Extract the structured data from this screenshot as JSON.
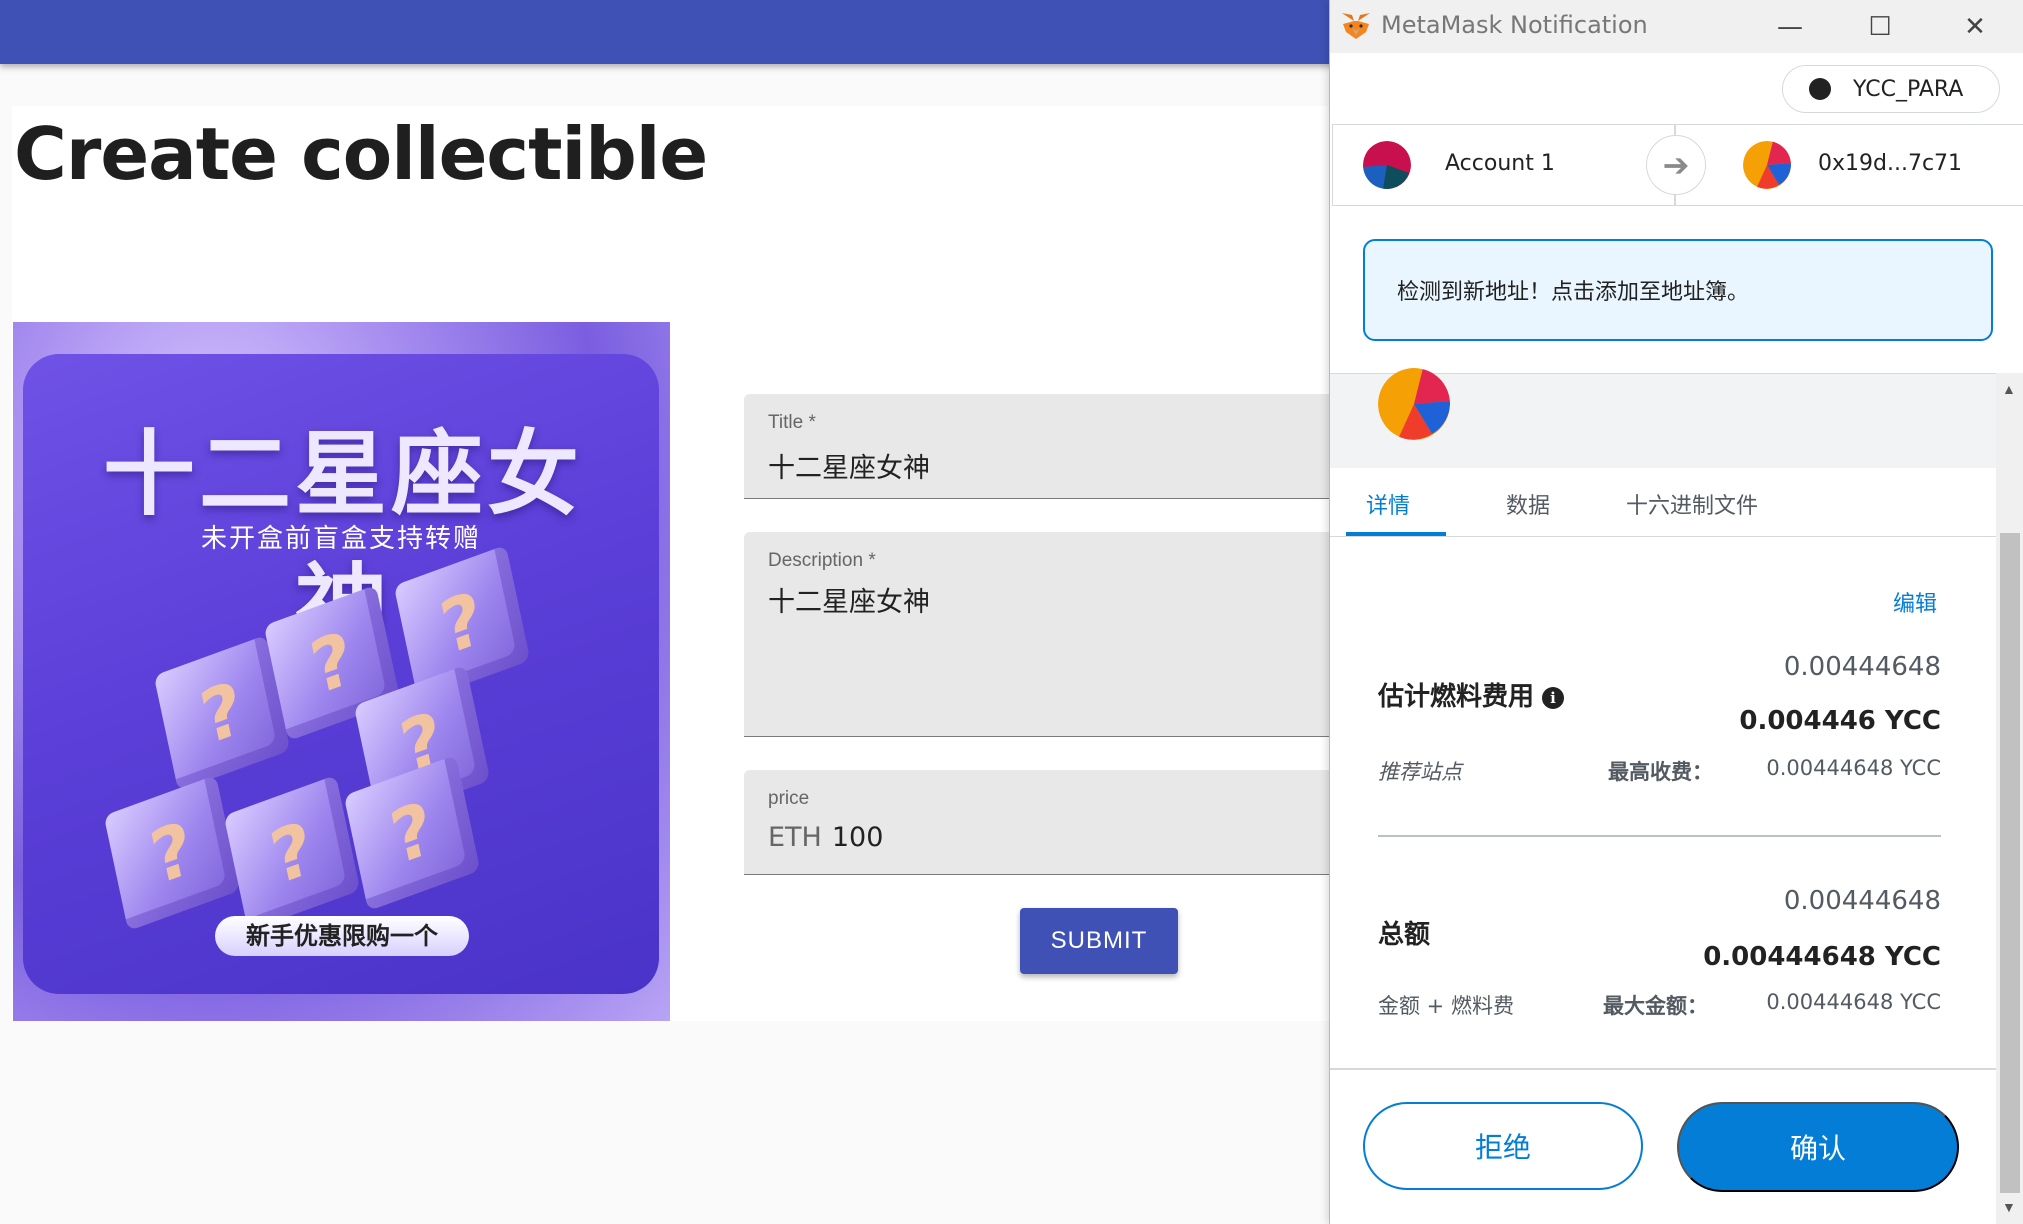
{
  "app": {
    "page_title": "Create collectible",
    "artwork": {
      "title": "十二星座女神",
      "subtitle": "未开盒前盲盒支持转赠",
      "badge": "新手优惠限购一个",
      "cube_glyph": "?"
    },
    "form": {
      "title_label": "Title *",
      "title_value": "十二星座女神",
      "description_label": "Description *",
      "description_value": "十二星座女神",
      "price_label": "price",
      "price_prefix": "ETH",
      "price_value": "100",
      "submit_label": "SUBMIT"
    },
    "colors": {
      "primary": "#3f51b5"
    }
  },
  "metamask": {
    "window_title": "MetaMask Notification",
    "window_buttons": {
      "minimize": "—",
      "maximize": "☐",
      "close": "✕"
    },
    "network": "YCC_PARA",
    "from_account": "Account 1",
    "to_address": "0x19d...7c71",
    "arrow": "➔",
    "alert": "检测到新地址！点击添加至地址簿。",
    "tabs": [
      "详情",
      "数据",
      "十六进制文件"
    ],
    "edit_label": "编辑",
    "gas": {
      "label": "估计燃料费用",
      "info_glyph": "i",
      "amount": "0.00444648",
      "amount_bold": "0.004446 YCC",
      "sub_label": "推荐站点",
      "max_label": "最高收费：",
      "max_value": "0.00444648 YCC"
    },
    "total": {
      "label": "总额",
      "amount": "0.00444648",
      "amount_bold": "0.00444648 YCC",
      "sub_label": "金额 + 燃料费",
      "max_label": "最大金额：",
      "max_value": "0.00444648 YCC"
    },
    "reject_label": "拒绝",
    "confirm_label": "确认",
    "colors": {
      "accent": "#037dd6"
    }
  }
}
